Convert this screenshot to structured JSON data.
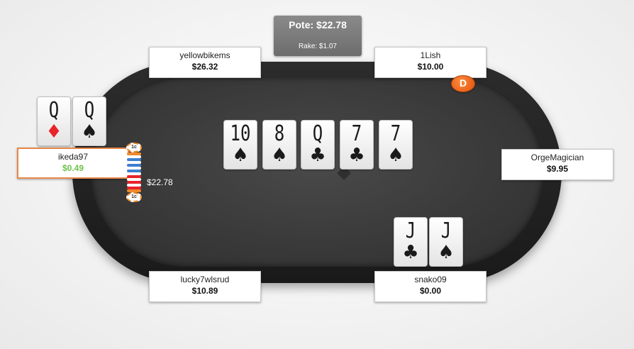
{
  "pot": {
    "label": "Pote: $22.78",
    "rake": "Rake: $1.07"
  },
  "seats": [
    {
      "name": "yellowbikems",
      "stack": "$26.32"
    },
    {
      "name": "1Lish",
      "stack": "$10.00"
    },
    {
      "name": "ikeda97",
      "stack": "$0.49"
    },
    {
      "name": "OrgeMagician",
      "stack": "$9.95"
    },
    {
      "name": "lucky7wlsrud",
      "stack": "$10.89"
    },
    {
      "name": "snako09",
      "stack": "$0.00"
    }
  ],
  "dealer_button": "D",
  "board": [
    {
      "rank": "10",
      "suit": "♠"
    },
    {
      "rank": "8",
      "suit": "♠"
    },
    {
      "rank": "Q",
      "suit": "♣"
    },
    {
      "rank": "7",
      "suit": "♣"
    },
    {
      "rank": "7",
      "suit": "♠"
    }
  ],
  "hero_cards": [
    {
      "rank": "Q",
      "suit": "♦"
    },
    {
      "rank": "Q",
      "suit": "♠"
    }
  ],
  "snako_cards": [
    {
      "rank": "J",
      "suit": "♣"
    },
    {
      "rank": "J",
      "suit": "♠"
    }
  ],
  "bet": {
    "amount": "$22.78",
    "chip_label": "1c"
  },
  "colors": {
    "accent": "#e8884a",
    "win_green": "#6cc24a",
    "dealer": "#e0520c",
    "felt": "#3a3a3a"
  }
}
